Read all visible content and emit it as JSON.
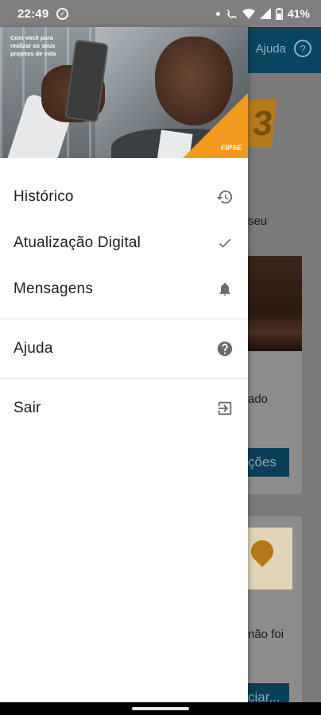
{
  "status_bar": {
    "time": "22:49",
    "battery": "41%"
  },
  "background": {
    "help_label": "Ajuda",
    "help_icon_glyph": "?",
    "badge_digit": "3",
    "text_1": "seu",
    "text_2": "ado",
    "button_1": "ções",
    "text_3": "não foi",
    "button_2": "ciar..."
  },
  "drawer": {
    "hero": {
      "tagline": "Com você para realizar os seus projetos de vida",
      "brand": "FIPSE"
    },
    "items": [
      {
        "label": "Histórico",
        "icon": "history-icon"
      },
      {
        "label": "Atualização Digital",
        "icon": "check-icon"
      },
      {
        "label": "Mensagens",
        "icon": "bell-icon"
      },
      {
        "label": "Ajuda",
        "icon": "help-circle-icon"
      },
      {
        "label": "Sair",
        "icon": "exit-icon"
      }
    ]
  },
  "colors": {
    "accent_orange": "#f39a1e",
    "header_blue": "#0a4560",
    "icon_gray": "#6b6b6b"
  }
}
